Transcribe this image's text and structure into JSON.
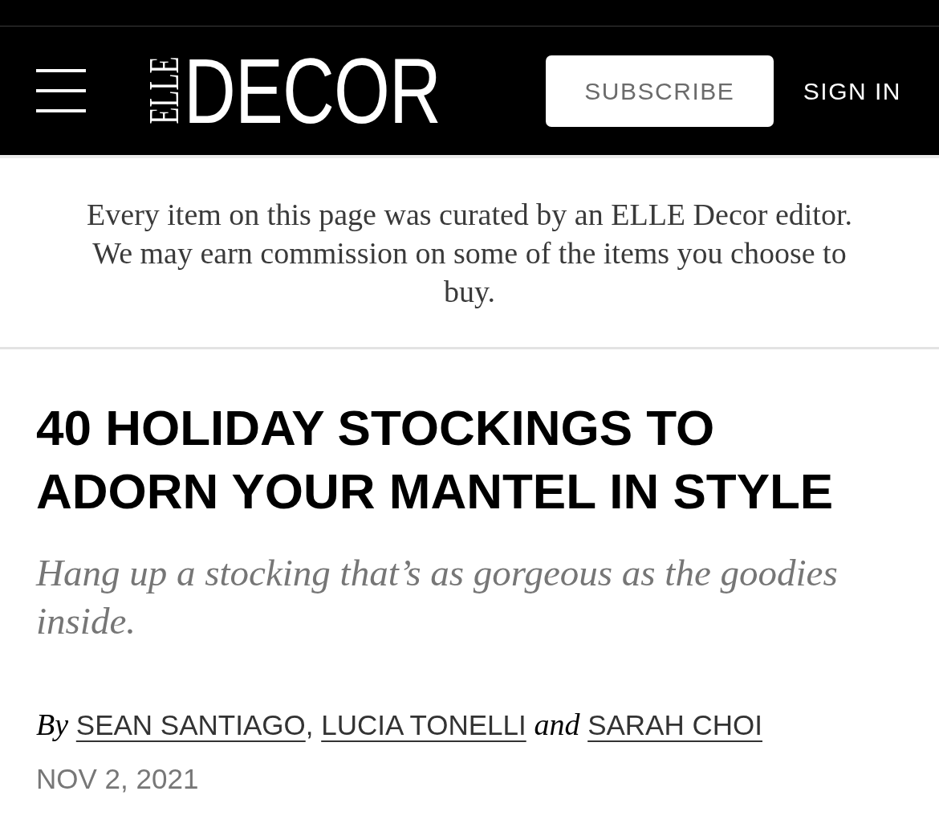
{
  "header": {
    "logo": {
      "prefix": "ELLE",
      "name": "DECOR"
    },
    "subscribe_button": "SUBSCRIBE",
    "sign_in": "SIGN IN"
  },
  "disclaimer": "Every item on this page was curated by an ELLE Decor editor. We may earn commission on some of the items you choose to buy.",
  "article": {
    "title": "40 HOLIDAY STOCKINGS TO ADORN YOUR MANTEL IN STYLE",
    "dek": "Hang up a stocking that’s as gorgeous as the goodies inside.",
    "byline": [
      {
        "kind": "word",
        "text": "By"
      },
      {
        "kind": "author",
        "text": "SEAN SANTIAGO"
      },
      {
        "kind": "punct",
        "text": ","
      },
      {
        "kind": "author",
        "text": "LUCIA TONELLI"
      },
      {
        "kind": "word",
        "text": "and"
      },
      {
        "kind": "author",
        "text": "SARAH CHOI"
      }
    ],
    "date": "NOV 2, 2021"
  }
}
